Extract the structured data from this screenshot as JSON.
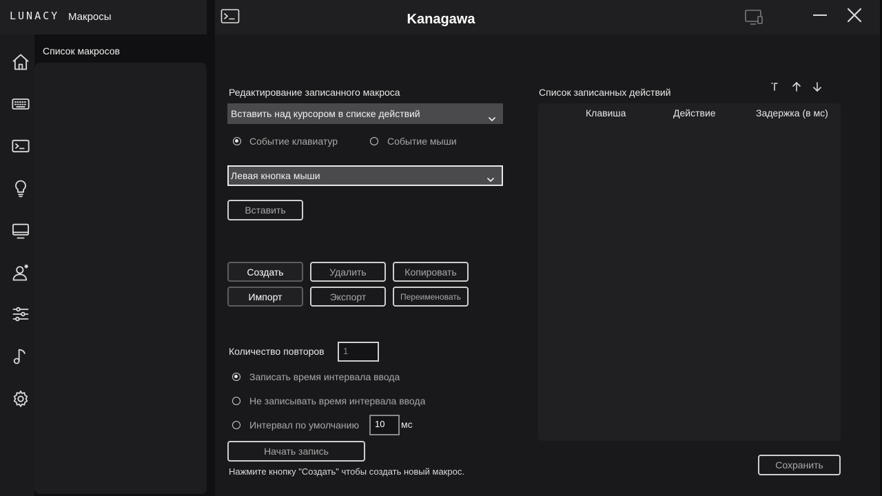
{
  "brand": {
    "logo": "LUNACY",
    "section": "Макросы"
  },
  "sidebar": {
    "icons": [
      "home-icon",
      "keyboard-icon",
      "terminal-icon",
      "lightbulb-icon",
      "monitor-icon",
      "user-icon",
      "sliders-icon",
      "music-icon",
      "gear-icon"
    ]
  },
  "macro_list": {
    "header": "Список макросов"
  },
  "window": {
    "device_name": "Kanagawa"
  },
  "editor": {
    "title": "Редактирование записанного макроса",
    "insert_mode": "Вставить над курсором в списке действий",
    "event_keyboard": "Событие клавиатур",
    "event_mouse": "Событие мыши",
    "key_select": "Левая кнопка мыши",
    "insert_button": "Вставить"
  },
  "buttons": {
    "create": "Создать",
    "delete": "Удалить",
    "copy": "Копировать",
    "import": "Импорт",
    "export": "Экспорт",
    "rename": "Переименовать"
  },
  "repeat": {
    "label": "Количество повторов",
    "placeholder": "1"
  },
  "recording": {
    "record_interval": "Записать время интервала ввода",
    "no_record_interval": "Не записывать время интервала ввода",
    "default_interval": "Интервал по умолчанию",
    "interval_value": "10",
    "unit": "мс",
    "start_button": "Начать запись",
    "hint": "Нажмите кнопку \"Создать\" чтобы создать новый макрос."
  },
  "actions": {
    "title": "Список записанных действий",
    "columns": [
      "Клавиша",
      "Действие",
      "Задержка (в мс)"
    ],
    "rows": []
  },
  "save_button": "Сохранить"
}
